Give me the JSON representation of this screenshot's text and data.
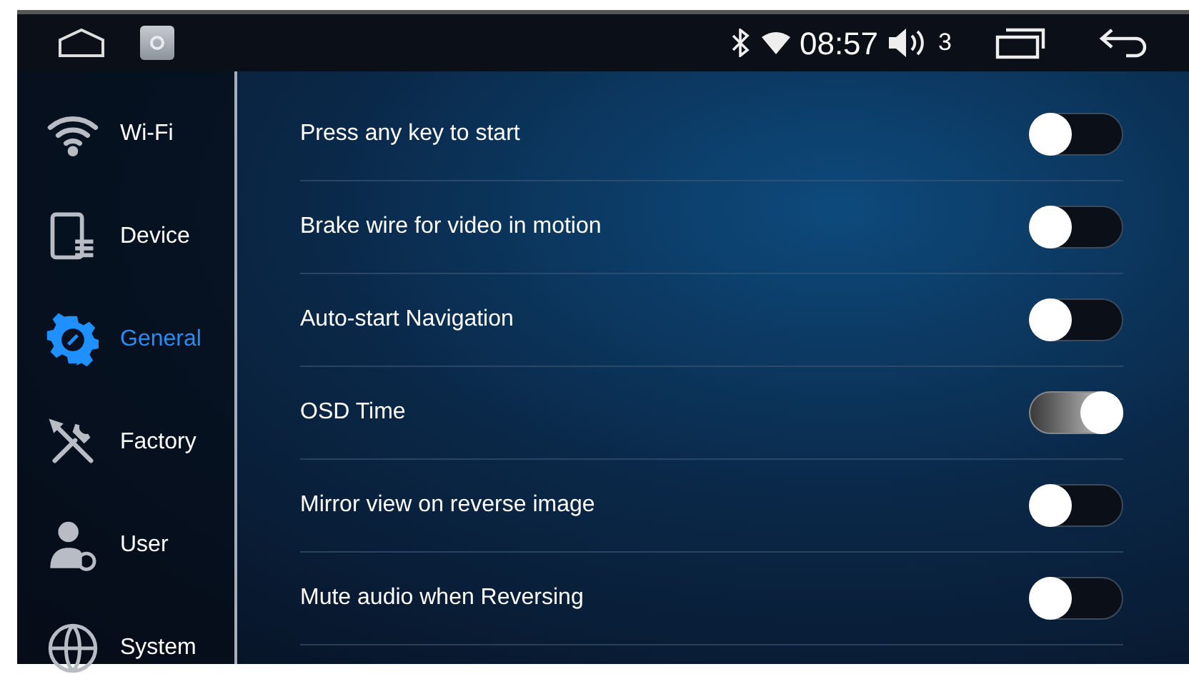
{
  "status_bar": {
    "time": "08:57",
    "volume": "3"
  },
  "sidebar": {
    "items": [
      {
        "label": "Wi-Fi",
        "kind": "wifi",
        "selected": false
      },
      {
        "label": "Device",
        "kind": "device",
        "selected": false
      },
      {
        "label": "General",
        "kind": "general",
        "selected": true
      },
      {
        "label": "Factory",
        "kind": "factory",
        "selected": false
      },
      {
        "label": "User",
        "kind": "user",
        "selected": false
      },
      {
        "label": "System",
        "kind": "system",
        "selected": false
      }
    ]
  },
  "settings": [
    {
      "label": "Press any key to start",
      "on": false
    },
    {
      "label": "Brake wire for video in motion",
      "on": false
    },
    {
      "label": "Auto-start Navigation",
      "on": false
    },
    {
      "label": "OSD Time",
      "on": true
    },
    {
      "label": "Mirror view on reverse image",
      "on": false
    },
    {
      "label": "Mute audio when Reversing",
      "on": false
    }
  ]
}
